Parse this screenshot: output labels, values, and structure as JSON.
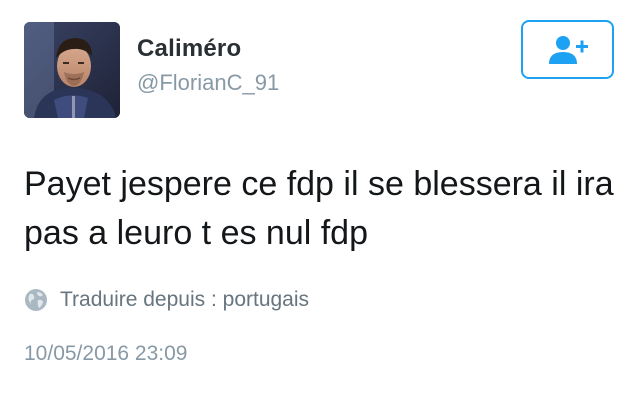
{
  "user": {
    "display_name": "Caliméro",
    "handle": "@FlorianC_91"
  },
  "follow_button": {
    "icon": "add-user-icon"
  },
  "tweet": {
    "text": "Payet jespere ce fdp il se blessera il ira pas a leuro t es nul fdp",
    "translate_icon": "globe-icon",
    "translate_label": "Traduire depuis : portugais",
    "timestamp": "10/05/2016 23:09"
  },
  "colors": {
    "accent": "#1da1f2",
    "text": "#14171a",
    "muted": "#8899a6",
    "secondary": "#66757f"
  }
}
